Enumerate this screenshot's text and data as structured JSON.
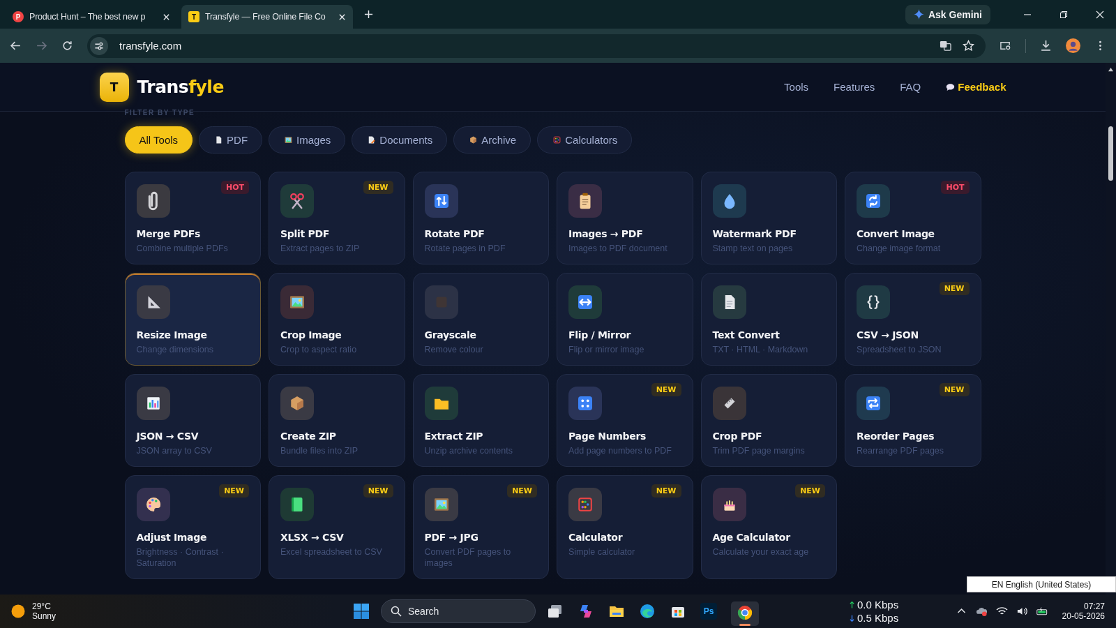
{
  "browser": {
    "tabs": [
      {
        "favicon": "P",
        "title": "Product Hunt – The best new p",
        "selected": false
      },
      {
        "favicon": "T",
        "title": "Transfyle — Free Online File Co",
        "selected": true
      }
    ],
    "ask_gemini": "Ask Gemini",
    "address": "transfyle.com"
  },
  "site": {
    "logo_letter": "T",
    "brand": [
      {
        "text": "Trans",
        "accent": false
      },
      {
        "text": "fyle",
        "accent": true
      }
    ],
    "nav": [
      {
        "label": "Tools",
        "kind": "link"
      },
      {
        "label": "Features",
        "kind": "link"
      },
      {
        "label": "FAQ",
        "kind": "link"
      },
      {
        "label": "Feedback",
        "kind": "feedback"
      }
    ]
  },
  "filter_label": "FILTER BY TYPE",
  "filters": [
    {
      "label": "All Tools",
      "selected": true
    },
    {
      "label": "PDF",
      "selected": false
    },
    {
      "label": "Images",
      "selected": false
    },
    {
      "label": "Documents",
      "selected": false
    },
    {
      "label": "Archive",
      "selected": false
    },
    {
      "label": "Calculators",
      "selected": false
    }
  ],
  "tools": [
    {
      "title": "Merge PDFs",
      "description": "Combine multiple PDFs",
      "badge": {
        "text": "HOT",
        "kind": "hot"
      },
      "hovered": false
    },
    {
      "title": "Split PDF",
      "description": "Extract pages to ZIP",
      "badge": {
        "text": "NEW",
        "kind": "new"
      },
      "hovered": false
    },
    {
      "title": "Rotate PDF",
      "description": "Rotate pages in PDF",
      "hovered": false
    },
    {
      "title": "Images → PDF",
      "description": "Images to PDF document",
      "hovered": false
    },
    {
      "title": "Watermark PDF",
      "description": "Stamp text on pages",
      "hovered": false
    },
    {
      "title": "Convert Image",
      "description": "Change image format",
      "badge": {
        "text": "HOT",
        "kind": "hot"
      },
      "hovered": false
    },
    {
      "title": "Resize Image",
      "description": "Change dimensions",
      "hovered": true
    },
    {
      "title": "Crop Image",
      "description": "Crop to aspect ratio",
      "hovered": false
    },
    {
      "title": "Grayscale",
      "description": "Remove colour",
      "hovered": false
    },
    {
      "title": "Flip / Mirror",
      "description": "Flip or mirror image",
      "hovered": false
    },
    {
      "title": "Text Convert",
      "description": "TXT · HTML · Markdown",
      "hovered": false
    },
    {
      "title": "CSV → JSON",
      "description": "Spreadsheet to JSON",
      "badge": {
        "text": "NEW",
        "kind": "new"
      },
      "hovered": false
    },
    {
      "title": "JSON → CSV",
      "description": "JSON array to CSV",
      "hovered": false
    },
    {
      "title": "Create ZIP",
      "description": "Bundle files into ZIP",
      "hovered": false
    },
    {
      "title": "Extract ZIP",
      "description": "Unzip archive contents",
      "hovered": false
    },
    {
      "title": "Page Numbers",
      "description": "Add page numbers to PDF",
      "badge": {
        "text": "NEW",
        "kind": "new"
      },
      "hovered": false
    },
    {
      "title": "Crop PDF",
      "description": "Trim PDF page margins",
      "hovered": false
    },
    {
      "title": "Reorder Pages",
      "description": "Rearrange PDF pages",
      "badge": {
        "text": "NEW",
        "kind": "new"
      },
      "hovered": false
    },
    {
      "title": "Adjust Image",
      "description": "Brightness · Contrast · Saturation",
      "badge": {
        "text": "NEW",
        "kind": "new"
      },
      "hovered": false
    },
    {
      "title": "XLSX → CSV",
      "description": "Excel spreadsheet to CSV",
      "badge": {
        "text": "NEW",
        "kind": "new"
      },
      "hovered": false
    },
    {
      "title": "PDF → JPG",
      "description": "Convert PDF pages to images",
      "badge": {
        "text": "NEW",
        "kind": "new"
      },
      "hovered": false
    },
    {
      "title": "Calculator",
      "description": "Simple calculator",
      "badge": {
        "text": "NEW",
        "kind": "new"
      },
      "hovered": false
    },
    {
      "title": "Age Calculator",
      "description": "Calculate your exact age",
      "badge": {
        "text": "NEW",
        "kind": "new"
      },
      "hovered": false
    }
  ],
  "language_tooltip": "EN English (United States)",
  "taskbar": {
    "temperature": "29°C",
    "condition": "Sunny",
    "search_placeholder": "Search",
    "app_label": "Ps",
    "upload": "0.0 Kbps",
    "download": "0.5 Kbps",
    "time": "07:27",
    "date": "20-05-2026"
  }
}
